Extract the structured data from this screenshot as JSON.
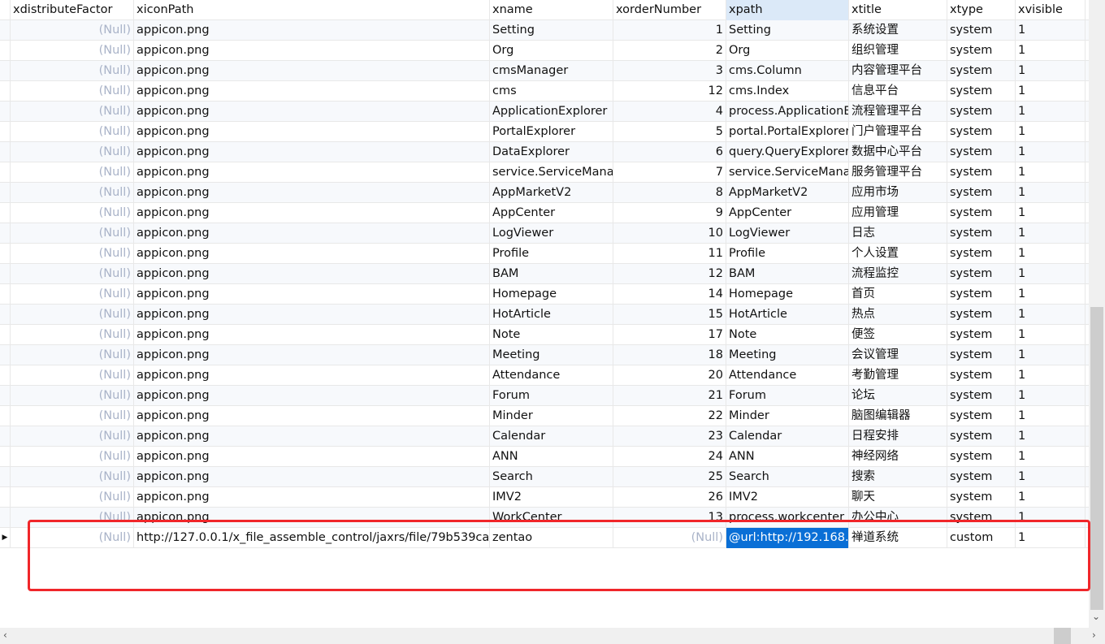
{
  "columns": [
    "xdistributeFactor",
    "xiconPath",
    "xname",
    "xorderNumber",
    "xpath",
    "xtitle",
    "xtype",
    "xvisible"
  ],
  "null_label": "(Null)",
  "rows": [
    {
      "icon": "appicon.png",
      "name": "Setting",
      "order": "1",
      "path": "Setting",
      "title": "系统设置",
      "type": "system",
      "visible": "1"
    },
    {
      "icon": "appicon.png",
      "name": "Org",
      "order": "2",
      "path": "Org",
      "title": "组织管理",
      "type": "system",
      "visible": "1"
    },
    {
      "icon": "appicon.png",
      "name": "cmsManager",
      "order": "3",
      "path": "cms.Column",
      "title": "内容管理平台",
      "type": "system",
      "visible": "1"
    },
    {
      "icon": "appicon.png",
      "name": "cms",
      "order": "12",
      "path": "cms.Index",
      "title": "信息平台",
      "type": "system",
      "visible": "1"
    },
    {
      "icon": "appicon.png",
      "name": "ApplicationExplorer",
      "order": "4",
      "path": "process.ApplicationE",
      "title": "流程管理平台",
      "type": "system",
      "visible": "1"
    },
    {
      "icon": "appicon.png",
      "name": "PortalExplorer",
      "order": "5",
      "path": "portal.PortalExplorer",
      "title": "门户管理平台",
      "type": "system",
      "visible": "1"
    },
    {
      "icon": "appicon.png",
      "name": "DataExplorer",
      "order": "6",
      "path": "query.QueryExplorer",
      "title": "数据中心平台",
      "type": "system",
      "visible": "1"
    },
    {
      "icon": "appicon.png",
      "name": "service.ServiceMana",
      "order": "7",
      "path": "service.ServiceMana",
      "title": "服务管理平台",
      "type": "system",
      "visible": "1"
    },
    {
      "icon": "appicon.png",
      "name": "AppMarketV2",
      "order": "8",
      "path": "AppMarketV2",
      "title": "应用市场",
      "type": "system",
      "visible": "1"
    },
    {
      "icon": "appicon.png",
      "name": "AppCenter",
      "order": "9",
      "path": "AppCenter",
      "title": "应用管理",
      "type": "system",
      "visible": "1"
    },
    {
      "icon": "appicon.png",
      "name": "LogViewer",
      "order": "10",
      "path": "LogViewer",
      "title": "日志",
      "type": "system",
      "visible": "1"
    },
    {
      "icon": "appicon.png",
      "name": "Profile",
      "order": "11",
      "path": "Profile",
      "title": "个人设置",
      "type": "system",
      "visible": "1"
    },
    {
      "icon": "appicon.png",
      "name": "BAM",
      "order": "12",
      "path": "BAM",
      "title": "流程监控",
      "type": "system",
      "visible": "1"
    },
    {
      "icon": "appicon.png",
      "name": "Homepage",
      "order": "14",
      "path": "Homepage",
      "title": "首页",
      "type": "system",
      "visible": "1"
    },
    {
      "icon": "appicon.png",
      "name": "HotArticle",
      "order": "15",
      "path": "HotArticle",
      "title": "热点",
      "type": "system",
      "visible": "1"
    },
    {
      "icon": "appicon.png",
      "name": "Note",
      "order": "17",
      "path": "Note",
      "title": "便签",
      "type": "system",
      "visible": "1"
    },
    {
      "icon": "appicon.png",
      "name": "Meeting",
      "order": "18",
      "path": "Meeting",
      "title": "会议管理",
      "type": "system",
      "visible": "1"
    },
    {
      "icon": "appicon.png",
      "name": "Attendance",
      "order": "20",
      "path": "Attendance",
      "title": "考勤管理",
      "type": "system",
      "visible": "1"
    },
    {
      "icon": "appicon.png",
      "name": "Forum",
      "order": "21",
      "path": "Forum",
      "title": "论坛",
      "type": "system",
      "visible": "1"
    },
    {
      "icon": "appicon.png",
      "name": "Minder",
      "order": "22",
      "path": "Minder",
      "title": "脑图编辑器",
      "type": "system",
      "visible": "1"
    },
    {
      "icon": "appicon.png",
      "name": "Calendar",
      "order": "23",
      "path": "Calendar",
      "title": "日程安排",
      "type": "system",
      "visible": "1"
    },
    {
      "icon": "appicon.png",
      "name": "ANN",
      "order": "24",
      "path": "ANN",
      "title": "神经网络",
      "type": "system",
      "visible": "1"
    },
    {
      "icon": "appicon.png",
      "name": "Search",
      "order": "25",
      "path": "Search",
      "title": "搜索",
      "type": "system",
      "visible": "1"
    },
    {
      "icon": "appicon.png",
      "name": "IMV2",
      "order": "26",
      "path": "IMV2",
      "title": "聊天",
      "type": "system",
      "visible": "1"
    },
    {
      "icon": "appicon.png",
      "name": "WorkCenter",
      "order": "13",
      "path": "process.workcenter",
      "title": "办公中心",
      "type": "system",
      "visible": "1"
    },
    {
      "icon": "http://127.0.0.1/x_file_assemble_control/jaxrs/file/79b539ca",
      "name": "zentao",
      "order": null,
      "path": "@url:http://192.168.",
      "title": "禅道系统",
      "type": "custom",
      "visible": "1",
      "current": true
    }
  ],
  "current_row_marker": "▶",
  "highlight_color": "#f0262a",
  "selection_color": "#0a6fd6"
}
